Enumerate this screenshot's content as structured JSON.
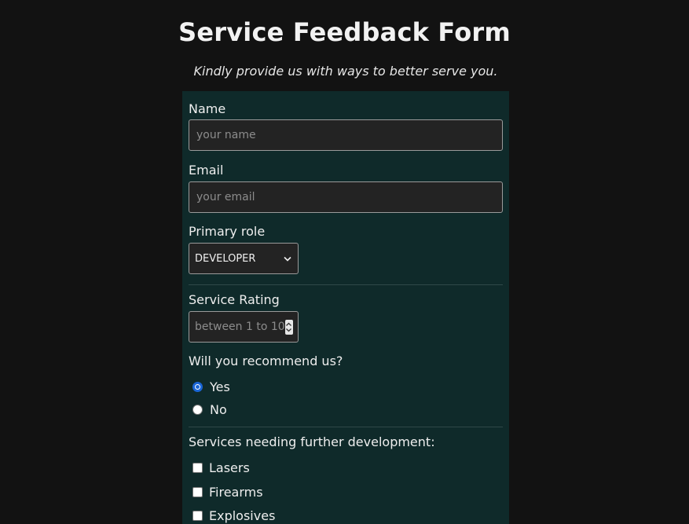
{
  "header": {
    "title": "Service Feedback Form",
    "subtitle": "Kindly provide us with ways to better serve you."
  },
  "form": {
    "name": {
      "label": "Name",
      "placeholder": "your name",
      "value": ""
    },
    "email": {
      "label": "Email",
      "placeholder": "your email",
      "value": ""
    },
    "primary_role": {
      "label": "Primary role",
      "selected": "DEVELOPER",
      "icon": "chevron-down-icon"
    },
    "service_rating": {
      "label": "Service Rating",
      "placeholder": "between 1 to 10",
      "value": ""
    },
    "recommend": {
      "label": "Will you recommend us?",
      "options": [
        {
          "label": "Yes",
          "checked": true
        },
        {
          "label": "No",
          "checked": false
        }
      ]
    },
    "services": {
      "label": "Services needing further development:",
      "options": [
        {
          "label": "Lasers",
          "checked": false
        },
        {
          "label": "Firearms",
          "checked": false
        },
        {
          "label": "Explosives",
          "checked": false
        }
      ]
    }
  },
  "colors": {
    "page_background": "#121212",
    "form_background": "#0f2a2a",
    "input_background": "#232323",
    "radio_accent": "#1a66d6"
  }
}
